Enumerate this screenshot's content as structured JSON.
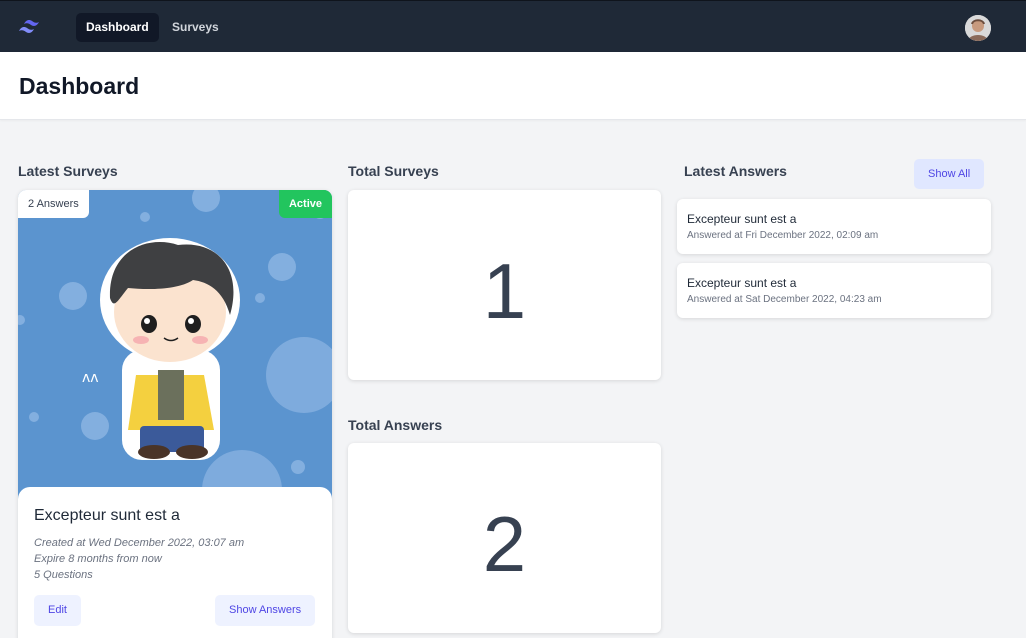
{
  "nav": {
    "links": [
      {
        "label": "Dashboard",
        "active": true
      },
      {
        "label": "Surveys",
        "active": false
      }
    ],
    "logo_icon": "tailwind-logo-icon",
    "avatar_icon": "user-avatar"
  },
  "page": {
    "title": "Dashboard"
  },
  "latest_surveys": {
    "title": "Latest Surveys",
    "card": {
      "answers_badge": "2 Answers",
      "status_badge": "Active",
      "name": "Excepteur sunt est a",
      "created": "Created at Wed December 2022, 03:07 am",
      "expire": "Expire 8 months from now",
      "questions": "5 Questions",
      "edit_label": "Edit",
      "show_answers_label": "Show Answers"
    }
  },
  "total_surveys": {
    "title": "Total Surveys",
    "value": "1"
  },
  "total_answers": {
    "title": "Total Answers",
    "value": "2"
  },
  "latest_answers": {
    "title": "Latest Answers",
    "show_all_label": "Show All",
    "items": [
      {
        "title": "Excepteur sunt est a",
        "time": "Answered at Fri December 2022, 02:09 am"
      },
      {
        "title": "Excepteur sunt est a",
        "time": "Answered at Sat December 2022, 04:23 am"
      }
    ]
  },
  "colors": {
    "navbar": "#1f2937",
    "accent": "#4f46e5",
    "active_badge": "#22c55e",
    "card_image_bg": "#5b94cf"
  }
}
